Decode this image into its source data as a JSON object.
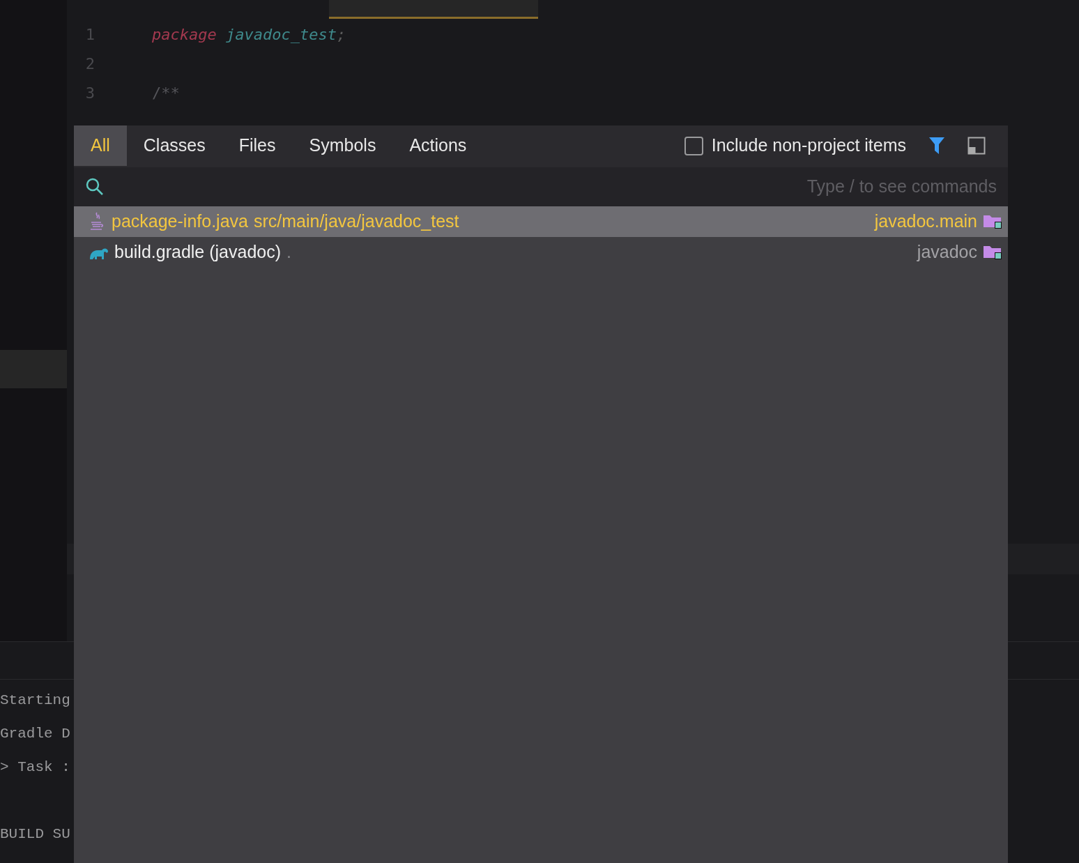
{
  "editor": {
    "lines": [
      {
        "number": "1",
        "kind": "package",
        "keyword": "package",
        "name": "javadoc_test",
        "punct": ";"
      },
      {
        "number": "2",
        "kind": "blank"
      },
      {
        "number": "3",
        "kind": "comment",
        "text": "/**"
      }
    ]
  },
  "terminal": {
    "lines": [
      {
        "kind": "output",
        "text": "Starting"
      },
      {
        "kind": "output",
        "text": "Gradle D"
      },
      {
        "kind": "output",
        "text": "> Task :"
      },
      {
        "kind": "blank"
      },
      {
        "kind": "output",
        "text": "BUILD SU"
      }
    ]
  },
  "popup": {
    "tabs": [
      {
        "label": "All",
        "selected": true
      },
      {
        "label": "Classes",
        "selected": false
      },
      {
        "label": "Files",
        "selected": false
      },
      {
        "label": "Symbols",
        "selected": false
      },
      {
        "label": "Actions",
        "selected": false
      }
    ],
    "include_non_project": {
      "label": "Include non-project items",
      "checked": false
    },
    "search": {
      "placeholder": "Type / to see commands"
    },
    "results": [
      {
        "kind": "java",
        "name": "package-info.java",
        "path": "src/main/java/javadoc_test",
        "module": "javadoc.main",
        "selected": true
      },
      {
        "kind": "gradle",
        "name": "build.gradle (javadoc)",
        "path": ".",
        "module": "javadoc",
        "selected": false
      }
    ]
  }
}
